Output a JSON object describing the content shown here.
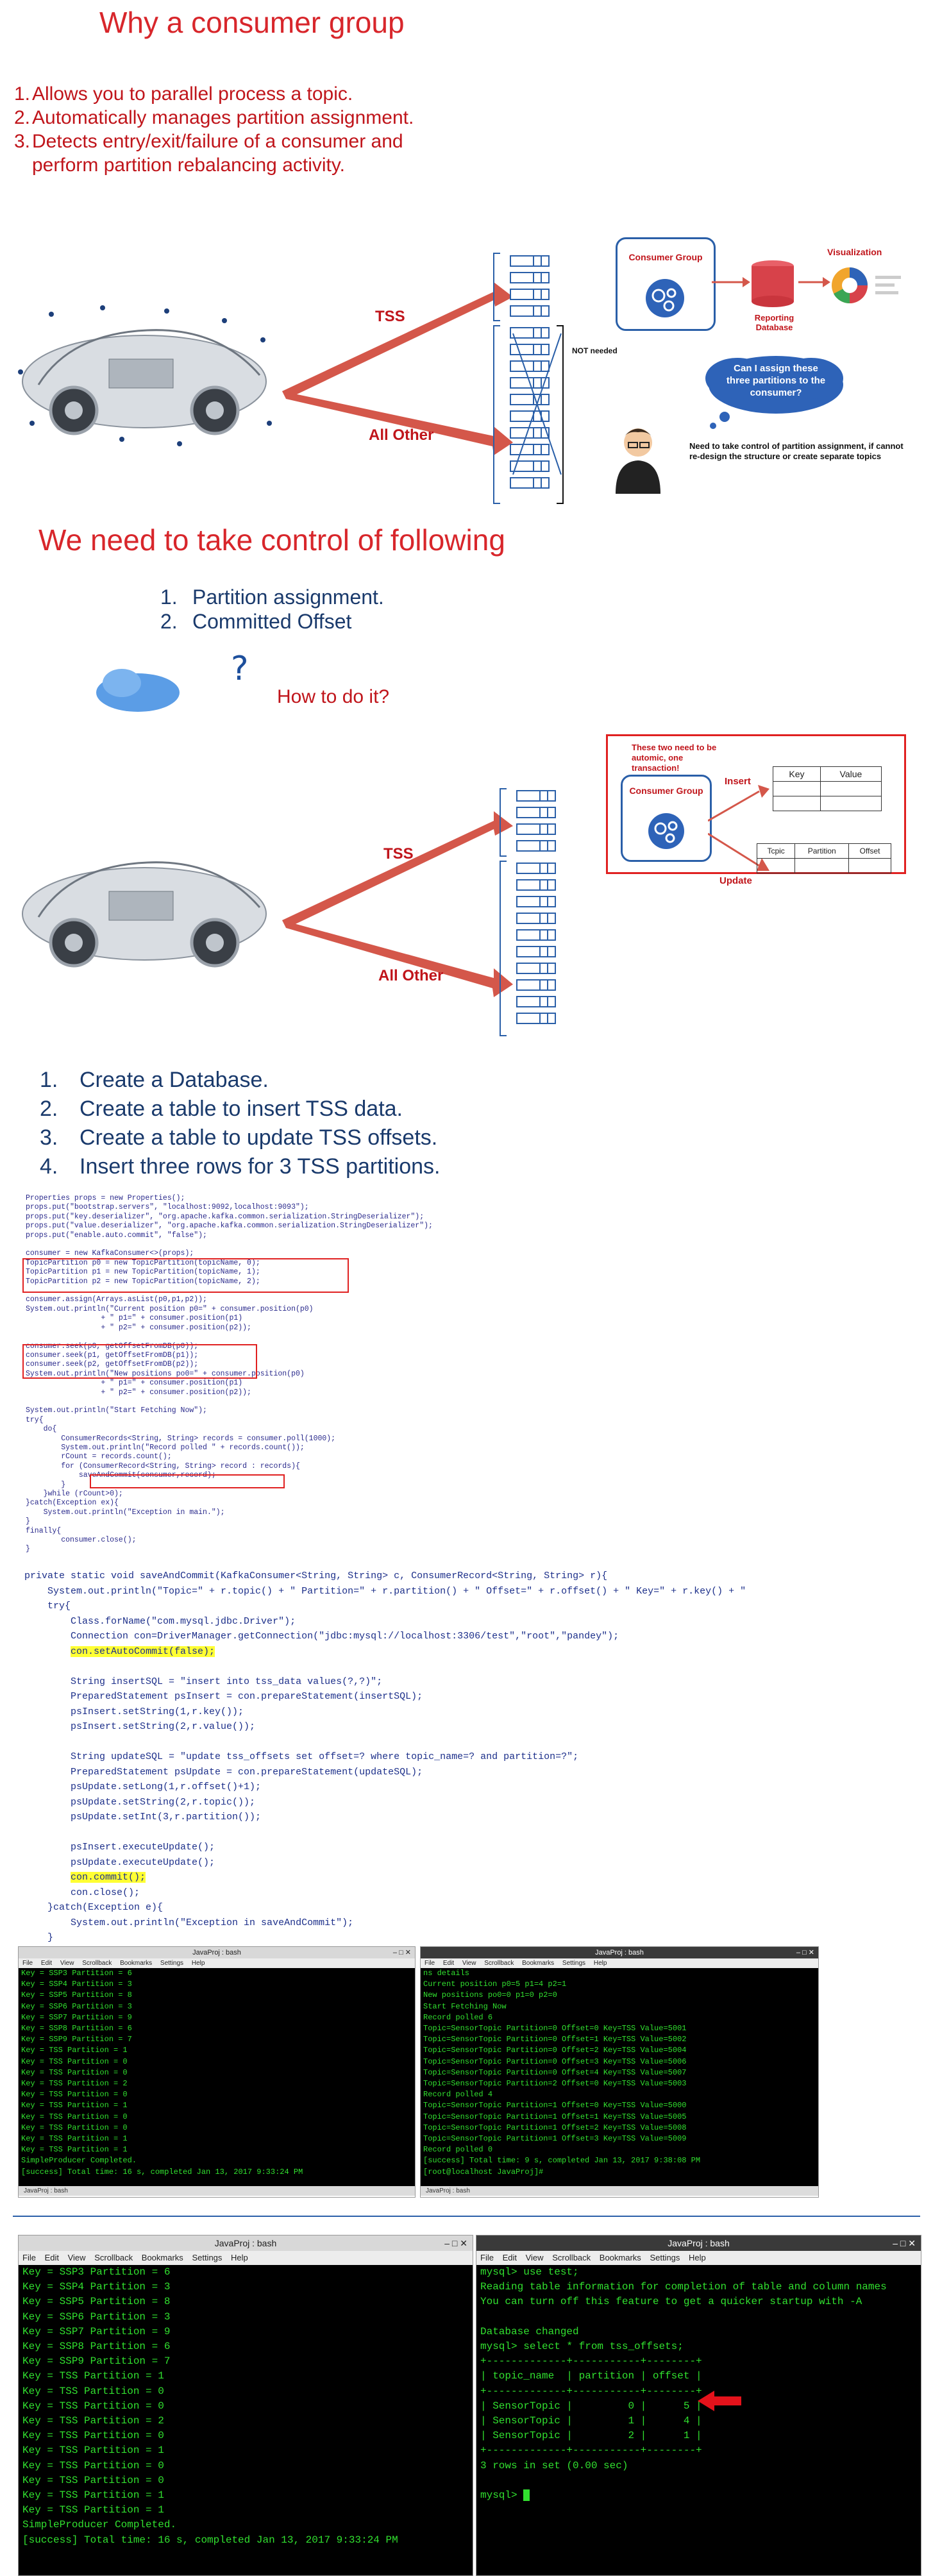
{
  "slide1": {
    "title": "Why a consumer group",
    "points": [
      {
        "n": "1.",
        "text": "Allows you to parallel process a topic."
      },
      {
        "n": "2.",
        "text": "Automatically manages partition assignment."
      },
      {
        "n": "3.",
        "text": "Detects entry/exit/failure of a consumer and"
      },
      {
        "n": "",
        "text": "perform partition rebalancing activity."
      }
    ]
  },
  "diagram1": {
    "tss_label": "TSS",
    "all_other_label": "All Other",
    "consumer_group_label": "Consumer Group",
    "reporting_db_label": "Reporting Database",
    "visualization_label": "Visualization",
    "not_needed_label": "NOT needed",
    "cloud_text": "Can I assign these three partitions to the consumer?",
    "control_note": "Need to take control of partition assignment, if cannot re-design the structure or create separate topics",
    "colors": {
      "arrow": "#d4574a",
      "partition": "#2a5fa8",
      "cloud": "#2e63b8",
      "db": "#d7424a"
    }
  },
  "slide2": {
    "title": "We need to take control of following",
    "points": [
      {
        "n": "1.",
        "text": "Partition assignment."
      },
      {
        "n": "2.",
        "text": "Committed Offset"
      }
    ],
    "question": "How to do it?"
  },
  "diagram2": {
    "tss_label": "TSS",
    "all_other_label": "All Other",
    "consumer_group_label": "Consumer Group",
    "atomic_note": "These two need to be automic, one transaction!",
    "insert_label": "Insert",
    "update_label": "Update",
    "data_table_headers": [
      "Key",
      "Value"
    ],
    "offset_table_headers": [
      "Tcpic",
      "Partition",
      "Offset"
    ]
  },
  "slide3": {
    "points": [
      {
        "n": "1.",
        "text": "Create a Database."
      },
      {
        "n": "2.",
        "text": "Create a table to insert TSS data."
      },
      {
        "n": "3.",
        "text": "Create a table to update TSS offsets."
      },
      {
        "n": "4.",
        "text": "Insert three rows for 3 TSS partitions."
      }
    ]
  },
  "code1": {
    "lines": [
      "Properties props = new Properties();",
      "props.put(\"bootstrap.servers\", \"localhost:9092,localhost:9093\");",
      "props.put(\"key.deserializer\", \"org.apache.kafka.common.serialization.StringDeserializer\");",
      "props.put(\"value.deserializer\", \"org.apache.kafka.common.serialization.StringDeserializer\");",
      "props.put(\"enable.auto.commit\", \"false\");",
      "",
      "consumer = new KafkaConsumer<>(props);",
      "TopicPartition p0 = new TopicPartition(topicName, 0);",
      "TopicPartition p1 = new TopicPartition(topicName, 1);",
      "TopicPartition p2 = new TopicPartition(topicName, 2);",
      "",
      "consumer.assign(Arrays.asList(p0,p1,p2));",
      "System.out.println(\"Current position p0=\" + consumer.position(p0)",
      "                 + \" p1=\" + consumer.position(p1)",
      "                 + \" p2=\" + consumer.position(p2));",
      "",
      "consumer.seek(p0, getOffsetFromDB(p0));",
      "consumer.seek(p1, getOffsetFromDB(p1));",
      "consumer.seek(p2, getOffsetFromDB(p2));",
      "System.out.println(\"New positions po0=\" + consumer.position(p0)",
      "                 + \" p1=\" + consumer.position(p1)",
      "                 + \" p2=\" + consumer.position(p2));",
      "",
      "System.out.println(\"Start Fetching Now\");",
      "try{",
      "    do{",
      "        ConsumerRecords<String, String> records = consumer.poll(1000);",
      "        System.out.println(\"Record polled \" + records.count());",
      "        rCount = records.count();",
      "        for (ConsumerRecord<String, String> record : records){",
      "            saveAndCommit(consumer,record);",
      "        }",
      "    }while (rCount>0);",
      "}catch(Exception ex){",
      "    System.out.println(\"Exception in main.\");",
      "}",
      "finally{",
      "        consumer.close();",
      "}"
    ]
  },
  "code2": {
    "lines": [
      "private static void saveAndCommit(KafkaConsumer<String, String> c, ConsumerRecord<String, String> r){",
      "    System.out.println(\"Topic=\" + r.topic() + \" Partition=\" + r.partition() + \" Offset=\" + r.offset() + \" Key=\" + r.key() + \"",
      "    try{",
      "        Class.forName(\"com.mysql.jdbc.Driver\");",
      "        Connection con=DriverManager.getConnection(\"jdbc:mysql://localhost:3306/test\",\"root\",\"pandey\");",
      "        con.setAutoCommit(false);",
      "",
      "        String insertSQL = \"insert into tss_data values(?,?)\";",
      "        PreparedStatement psInsert = con.prepareStatement(insertSQL);",
      "        psInsert.setString(1,r.key());",
      "        psInsert.setString(2,r.value());",
      "",
      "        String updateSQL = \"update tss_offsets set offset=? where topic_name=? and partition=?\";",
      "        PreparedStatement psUpdate = con.prepareStatement(updateSQL);",
      "        psUpdate.setLong(1,r.offset()+1);",
      "        psUpdate.setString(2,r.topic());",
      "        psUpdate.setInt(3,r.partition());",
      "",
      "        psInsert.executeUpdate();",
      "        psUpdate.executeUpdate();",
      "        con.commit();",
      "        con.close();",
      "    }catch(Exception e){",
      "        System.out.println(\"Exception in saveAndCommit\");",
      "    }"
    ]
  },
  "terminals1": {
    "left": {
      "title": "JavaProj : bash",
      "menu": [
        "File",
        "Edit",
        "View",
        "Scrollback",
        "Bookmarks",
        "Settings",
        "Help"
      ],
      "lines": [
        "Key = SSP3 Partition = 6",
        "Key = SSP4 Partition = 3",
        "Key = SSP5 Partition = 8",
        "Key = SSP6 Partition = 3",
        "Key = SSP7 Partition = 9",
        "Key = SSP8 Partition = 6",
        "Key = SSP9 Partition = 7",
        "Key = TSS Partition = 1",
        "Key = TSS Partition = 0",
        "Key = TSS Partition = 0",
        "Key = TSS Partition = 2",
        "Key = TSS Partition = 0",
        "Key = TSS Partition = 1",
        "Key = TSS Partition = 0",
        "Key = TSS Partition = 0",
        "Key = TSS Partition = 1",
        "Key = TSS Partition = 1",
        "SimpleProducer Completed.",
        "[success] Total time: 16 s, completed Jan 13, 2017 9:33:24 PM"
      ],
      "status": "JavaProj : bash"
    },
    "right": {
      "title": "JavaProj : bash",
      "menu": [
        "File",
        "Edit",
        "View",
        "Scrollback",
        "Bookmarks",
        "Settings",
        "Help"
      ],
      "lines": [
        "ns details",
        "Current position p0=5 p1=4 p2=1",
        "New positions po0=0 p1=0 p2=0",
        "Start Fetching Now",
        "Record polled 6",
        "Topic=SensorTopic Partition=0 Offset=0 Key=TSS Value=5001",
        "Topic=SensorTopic Partition=0 Offset=1 Key=TSS Value=5002",
        "Topic=SensorTopic Partition=0 Offset=2 Key=TSS Value=5004",
        "Topic=SensorTopic Partition=0 Offset=3 Key=TSS Value=5006",
        "Topic=SensorTopic Partition=0 Offset=4 Key=TSS Value=5007",
        "Topic=SensorTopic Partition=2 Offset=0 Key=TSS Value=5003",
        "Record polled 4",
        "Topic=SensorTopic Partition=1 Offset=0 Key=TSS Value=5000",
        "Topic=SensorTopic Partition=1 Offset=1 Key=TSS Value=5005",
        "Topic=SensorTopic Partition=1 Offset=2 Key=TSS Value=5008",
        "Topic=SensorTopic Partition=1 Offset=3 Key=TSS Value=5009",
        "Record polled 0",
        "[success] Total time: 9 s, completed Jan 13, 2017 9:38:08 PM",
        "[root@localhost JavaProj]#"
      ],
      "status": "JavaProj : bash"
    }
  },
  "terminals2": {
    "left": {
      "title": "JavaProj : bash",
      "menu": [
        "File",
        "Edit",
        "View",
        "Scrollback",
        "Bookmarks",
        "Settings",
        "Help"
      ],
      "lines": [
        "Key = SSP3 Partition = 6",
        "Key = SSP4 Partition = 3",
        "Key = SSP5 Partition = 8",
        "Key = SSP6 Partition = 3",
        "Key = SSP7 Partition = 9",
        "Key = SSP8 Partition = 6",
        "Key = SSP9 Partition = 7",
        "Key = TSS Partition = 1",
        "Key = TSS Partition = 0",
        "Key = TSS Partition = 0",
        "Key = TSS Partition = 2",
        "Key = TSS Partition = 0",
        "Key = TSS Partition = 1",
        "Key = TSS Partition = 0",
        "Key = TSS Partition = 0",
        "Key = TSS Partition = 1",
        "Key = TSS Partition = 1",
        "SimpleProducer Completed.",
        "[success] Total time: 16 s, completed Jan 13, 2017 9:33:24 PM"
      ]
    },
    "right": {
      "title": "JavaProj : bash",
      "menu": [
        "File",
        "Edit",
        "View",
        "Scrollback",
        "Bookmarks",
        "Settings",
        "Help"
      ],
      "lines": [
        "mysql> use test;",
        "Reading table information for completion of table and column names",
        "You can turn off this feature to get a quicker startup with -A",
        "",
        "Database changed",
        "mysql> select * from tss_offsets;",
        "+-------------+-----------+--------+",
        "| topic_name  | partition | offset |",
        "+-------------+-----------+--------+",
        "| SensorTopic |         0 |      5 |",
        "| SensorTopic |         1 |      4 |",
        "| SensorTopic |         2 |      1 |",
        "+-------------+-----------+--------+",
        "3 rows in set (0.00 sec)",
        "",
        "mysql> "
      ]
    }
  }
}
